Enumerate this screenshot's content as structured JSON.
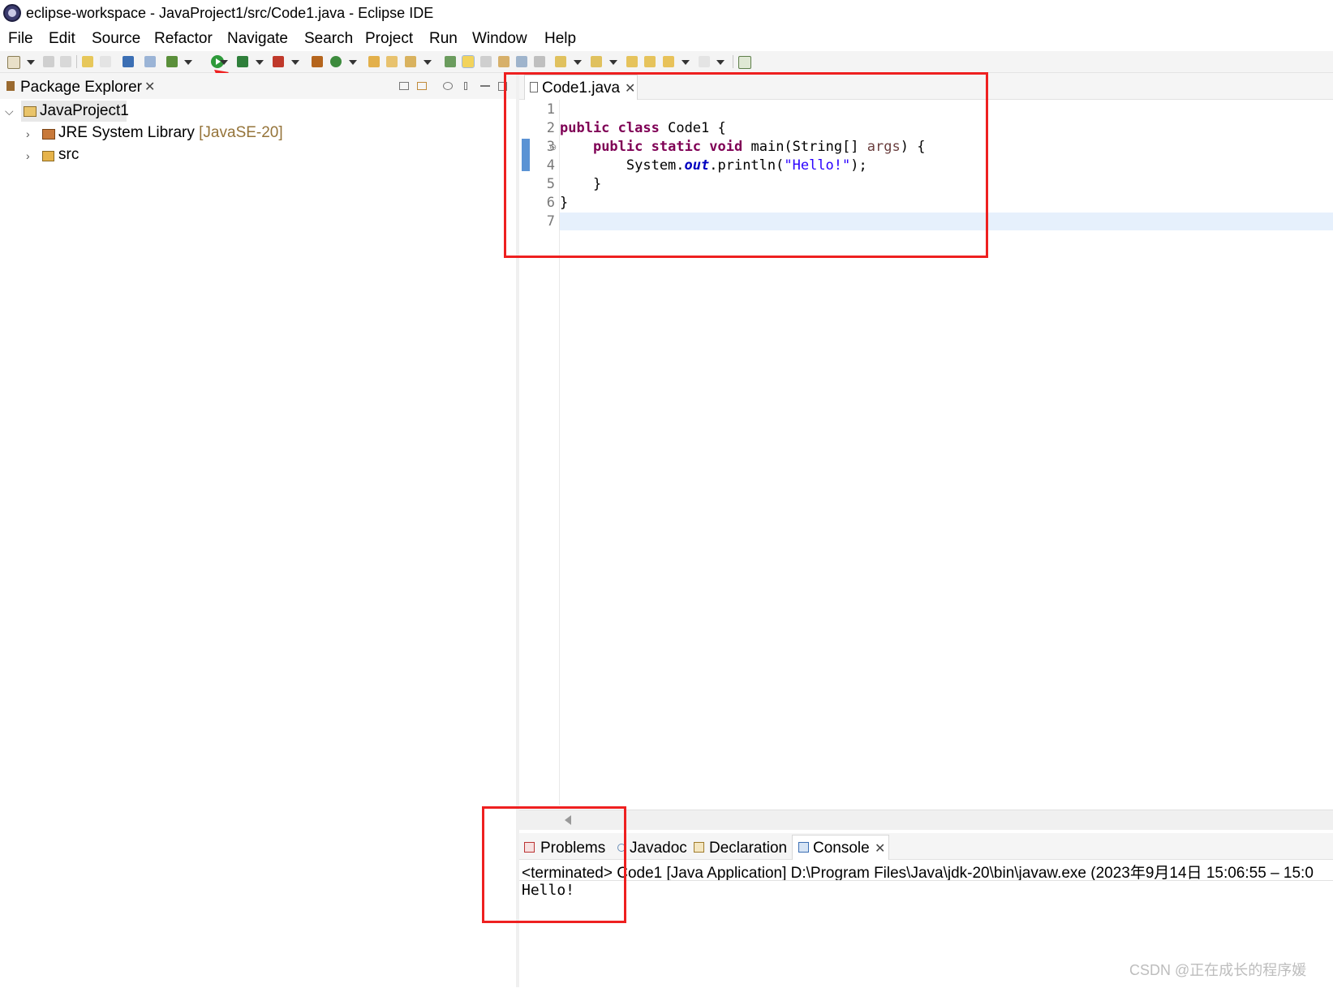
{
  "window": {
    "title": "eclipse-workspace - JavaProject1/src/Code1.java - Eclipse IDE"
  },
  "menu": {
    "items": [
      "File",
      "Edit",
      "Source",
      "Refactor",
      "Navigate",
      "Search",
      "Project",
      "Run",
      "Window",
      "Help"
    ]
  },
  "toolbar": {
    "run_icon": "run-icon"
  },
  "package_explorer": {
    "title": "Package Explorer",
    "close": "✕",
    "tree": {
      "project": "JavaProject1",
      "library_name": "JRE System Library",
      "library_version": "[JavaSE-20]",
      "src": "src"
    }
  },
  "editor": {
    "tab_label": "Code1.java",
    "tab_close": "✕",
    "line_numbers": [
      "1",
      "2",
      "3",
      "4",
      "5",
      "6",
      "7"
    ],
    "fold_marker": "⊖",
    "code": {
      "line2_kw1": "public",
      "line2_kw2": "class",
      "line2_rest": " Code1 {",
      "line3_indent": "    ",
      "line3_kw1": "public",
      "line3_kw2": "static",
      "line3_kw3": "void",
      "line3_mid": " main(String[] ",
      "line3_arg": "args",
      "line3_end": ") {",
      "line4_start": "        System.",
      "line4_field": "out",
      "line4_mid": ".println(",
      "line4_str": "\"Hello!\"",
      "line4_end": ");",
      "line5": "    }",
      "line6": "}"
    }
  },
  "bottom_panel": {
    "tabs": [
      "Problems",
      "Javadoc",
      "Declaration",
      "Console"
    ],
    "console_close": "✕",
    "status": "<terminated> Code1 [Java Application] D:\\Program Files\\Java\\jdk-20\\bin\\javaw.exe  (2023年9月14日 15:06:55 – 15:0",
    "output": "Hello!"
  },
  "watermark": "CSDN @正在成长的程序媛",
  "colors": {
    "keyword": "#7f0055",
    "string": "#2a00ff",
    "field": "#0000c0",
    "annotation_red": "#ee2020",
    "run_green": "#2e9a3a"
  }
}
